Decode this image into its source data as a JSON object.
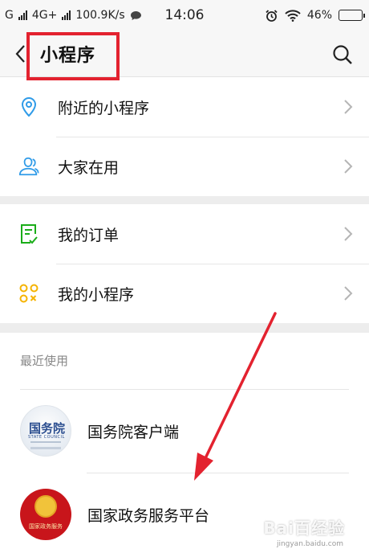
{
  "status_bar": {
    "carrier1": "G",
    "carrier2": "4G+",
    "speed": "100.9K/s",
    "time": "14:06",
    "battery_text": "46%",
    "battery_level": 0.46,
    "battery_color": "#e8c11a"
  },
  "header": {
    "title": "小程序"
  },
  "menu_group_1": [
    {
      "label": "附近的小程序",
      "icon": "location-pin-icon"
    },
    {
      "label": "大家在用",
      "icon": "users-icon"
    }
  ],
  "menu_group_2": [
    {
      "label": "我的订单",
      "icon": "order-checklist-icon"
    },
    {
      "label": "我的小程序",
      "icon": "mini-program-grid-icon"
    }
  ],
  "recent": {
    "section_label": "最近使用",
    "apps": [
      {
        "name": "国务院客户端",
        "logo_text": "国务院",
        "logo_subtext": "STATE COUNCIL"
      },
      {
        "name": "国家政务服务平台",
        "logo_subtext": "国家政务服务"
      }
    ]
  },
  "watermark": {
    "text": "Bai百经验",
    "subtext": "jingyan.baidu.com"
  },
  "colors": {
    "highlight_box": "#e3222f",
    "annotation_arrow": "#e3222f",
    "nearby_icon": "#2f9be8",
    "users_icon": "#2f9be8",
    "order_icon": "#1aad19",
    "mini_icon": "#f5b300"
  }
}
